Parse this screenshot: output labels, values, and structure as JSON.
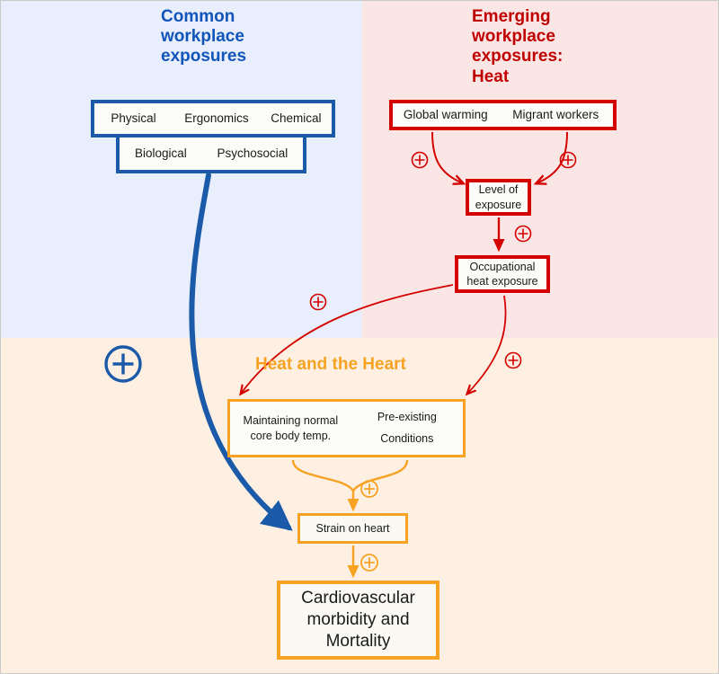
{
  "diagram": {
    "panels": {
      "top_left": {
        "title": "Common\nworkplace\nexposures",
        "color": "#1155bb",
        "background": "#e8eefb"
      },
      "top_right": {
        "title": "Emerging\nworkplace\nexposures:\nHeat",
        "color": "#c00000",
        "background": "#fbe6e6"
      },
      "bottom": {
        "title": "Heat and the Heart",
        "color": "#f7a223",
        "background": "#fdf0e2"
      }
    },
    "common_exposures": {
      "row1": [
        "Physical",
        "Ergonomics",
        "Chemical"
      ],
      "row2": [
        "Biological",
        "Psychosocial"
      ],
      "border_color": "#1b5aa8"
    },
    "heat_drivers": {
      "row1": [
        "Global warming",
        "Migrant workers"
      ],
      "border_color": "#d40000"
    },
    "nodes": {
      "level_of_exposure": "Level of\nexposure",
      "occupational_heat_exposure": "Occupational\nheat exposure",
      "maintaining_core_temp": "Maintaining normal\ncore body temp.",
      "pre_existing_conditions": "Pre-existing\nConditions",
      "strain_on_heart": "Strain on heart",
      "cardiovascular_outcome": "Cardiovascular\nmorbidity and\nMortality"
    },
    "edge_signs": [
      {
        "id": "global-warming-to-level",
        "sign": "+",
        "color": "#d40000"
      },
      {
        "id": "migrant-workers-to-level",
        "sign": "+",
        "color": "#d40000"
      },
      {
        "id": "level-to-occupational",
        "sign": "+",
        "color": "#d40000"
      },
      {
        "id": "occupational-to-core-temp",
        "sign": "+",
        "color": "#d40000"
      },
      {
        "id": "occupational-to-pre-existing",
        "sign": "+",
        "color": "#d40000"
      },
      {
        "id": "heart-factors-to-strain",
        "sign": "+",
        "color": "#f7a223"
      },
      {
        "id": "strain-to-cardiovascular",
        "sign": "+",
        "color": "#f7a223"
      },
      {
        "id": "common-exposures-to-strain",
        "sign": "+",
        "color": "#1b5aa8"
      }
    ]
  }
}
